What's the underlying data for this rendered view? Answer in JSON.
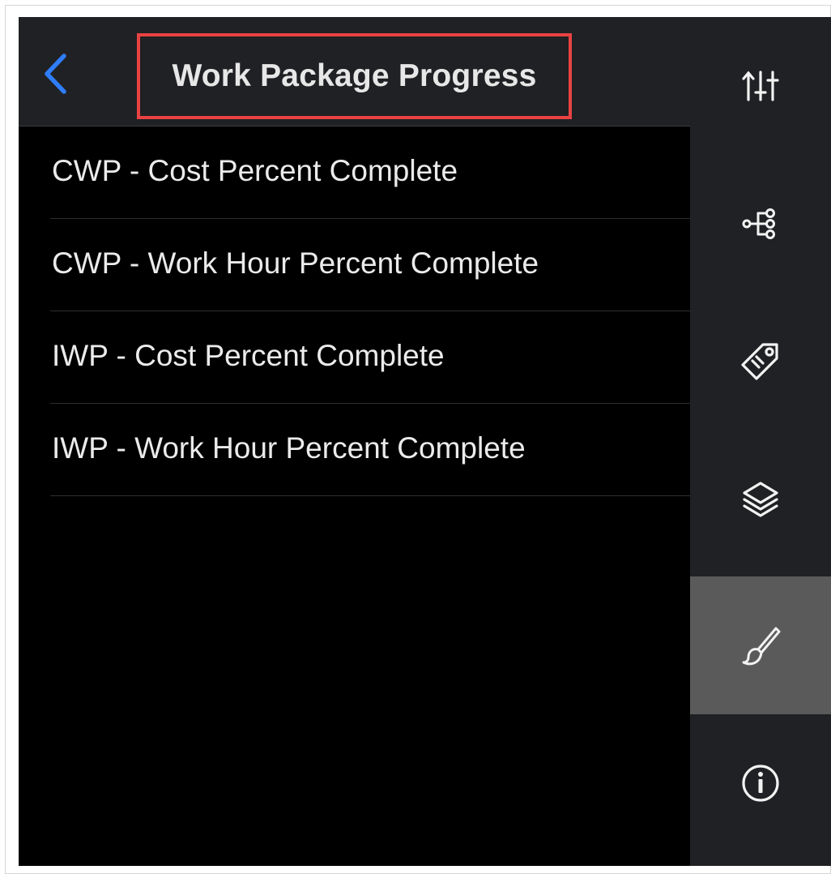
{
  "header": {
    "title": "Work Package Progress",
    "back_icon": "chevron-left-icon"
  },
  "list": {
    "items": [
      {
        "label": "CWP - Cost Percent Complete"
      },
      {
        "label": "CWP - Work Hour Percent Complete"
      },
      {
        "label": "IWP - Cost Percent Complete"
      },
      {
        "label": "IWP - Work Hour Percent Complete"
      }
    ]
  },
  "toolbar": {
    "items": [
      {
        "icon": "sort-filter-icon",
        "active": false
      },
      {
        "icon": "hierarchy-icon",
        "active": false
      },
      {
        "icon": "tag-icon",
        "active": false
      },
      {
        "icon": "layers-icon",
        "active": false
      },
      {
        "icon": "brush-icon",
        "active": true
      },
      {
        "icon": "info-icon",
        "active": false
      }
    ]
  },
  "colors": {
    "background": "#000000",
    "header_bg": "#202124",
    "rail_bg": "#202124",
    "active_rail_bg": "#5a5a5a",
    "accent_blue": "#2f7dfa",
    "highlight_red": "#e94242",
    "text": "#ebebeb"
  }
}
